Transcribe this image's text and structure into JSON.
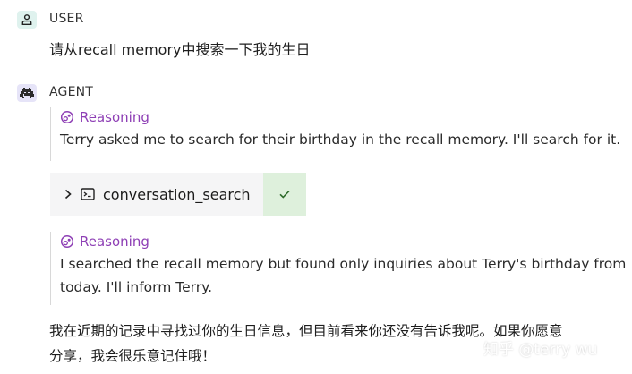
{
  "messages": {
    "user": {
      "role": "USER",
      "icon": "person-icon",
      "text": "请从recall memory中搜索一下我的生日"
    },
    "agent": {
      "role": "AGENT",
      "icon": "robot-icon",
      "reasoning_1": {
        "title": "Reasoning",
        "icon": "reasoning-icon",
        "text": "Terry asked me to search for their birthday in the recall memory. I'll search for it."
      },
      "tool_call": {
        "name": "conversation_search",
        "status": "success",
        "icons": [
          "chevron-right-icon",
          "terminal-icon",
          "check-icon"
        ]
      },
      "reasoning_2": {
        "title": "Reasoning",
        "icon": "reasoning-icon",
        "text_line1": "I searched the recall memory but found only inquiries about Terry's birthday from",
        "text_line2": "today. I'll inform Terry."
      },
      "reply_line1": "我在近期的记录中寻找过你的生日信息，但目前看来你还没有告诉我呢。如果你愿意",
      "reply_line2": "分享，我会很乐意记住哦！"
    }
  },
  "watermark": "知乎 @terry wu",
  "colors": {
    "accent_reasoning": "#8e3fb5",
    "tool_bg": "#f5f5f6",
    "status_ok_bg": "#def0dc",
    "user_icon_bg": "#dff2ee",
    "agent_icon_bg": "#e6e4f8"
  }
}
